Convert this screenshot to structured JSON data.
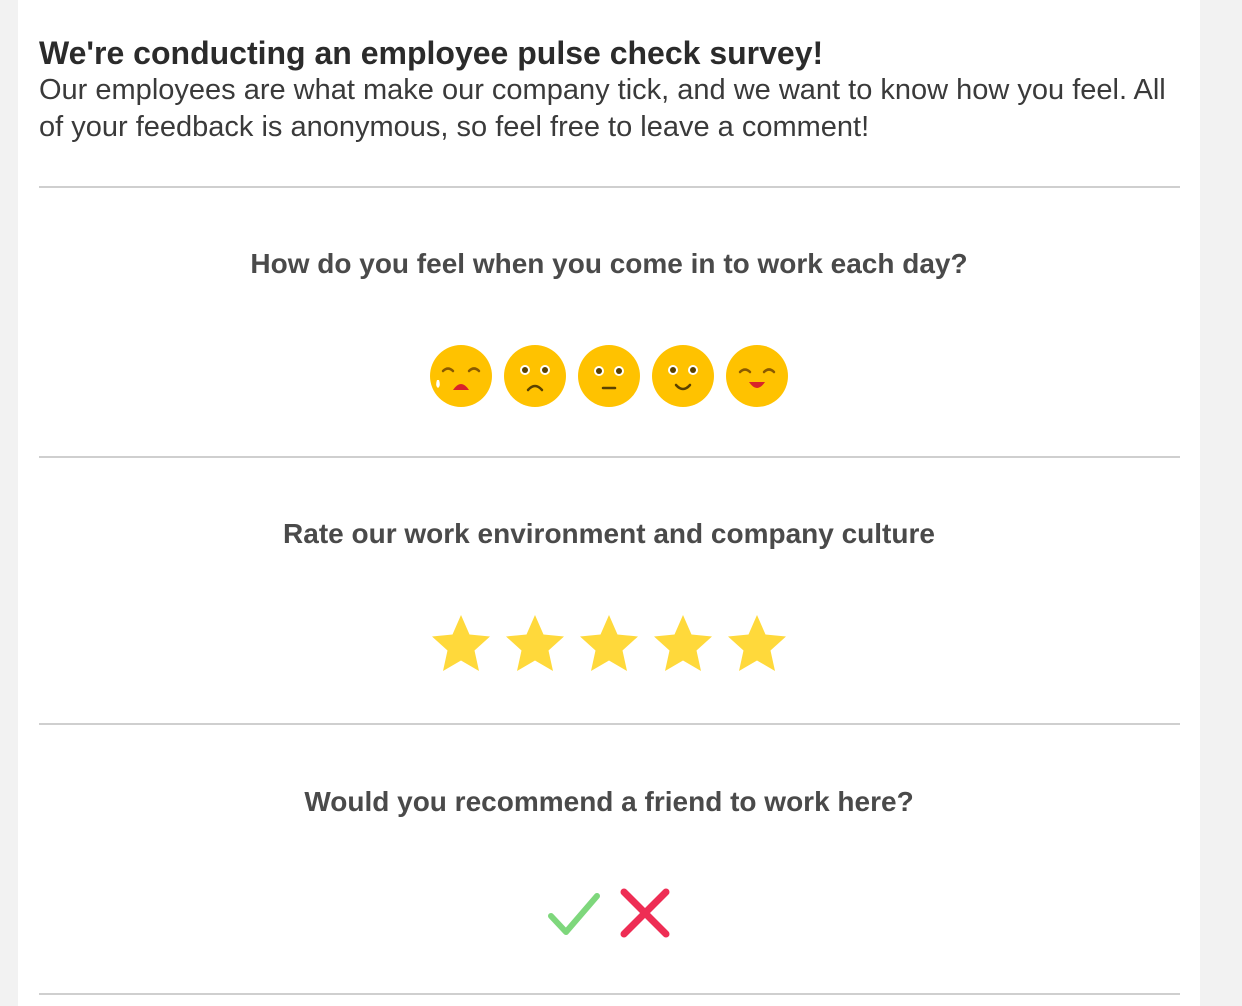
{
  "intro": {
    "title": "We're conducting an employee pulse check survey!",
    "text": "Our employees are what make our company tick, and we want to know how you feel. All of your feedback is anonymous, so feel free to leave a comment!"
  },
  "questions": [
    {
      "label": "How do you feel when you come in to work each day?",
      "type": "emoji",
      "options": [
        "crying-face-icon",
        "sad-face-icon",
        "neutral-face-icon",
        "smiling-face-icon",
        "happy-face-icon"
      ]
    },
    {
      "label": "Rate our work environment and company culture",
      "type": "stars",
      "max": 5
    },
    {
      "label": "Would you recommend a friend to work here?",
      "type": "yes-no",
      "options": [
        "checkmark-icon",
        "cross-icon"
      ]
    }
  ],
  "colors": {
    "emoji_face": "#FFC200",
    "star": "#FFD93B",
    "yes": "#7ED77C",
    "no": "#EE2D54",
    "divider": "#CFCFCF"
  }
}
